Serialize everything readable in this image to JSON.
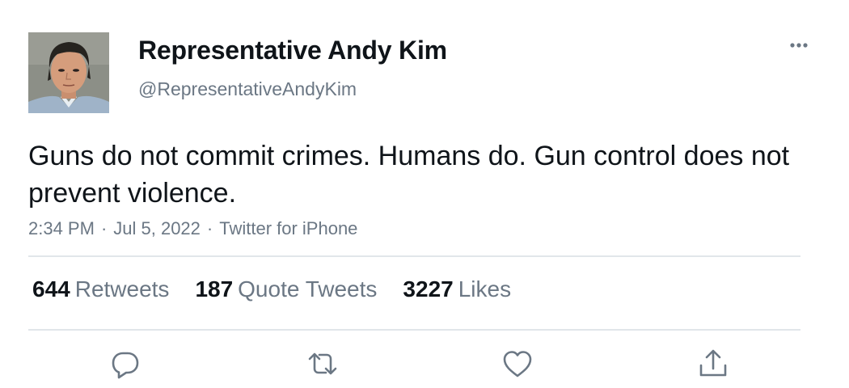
{
  "user": {
    "display_name": "Representative Andy Kim",
    "handle": "@RepresentativeAndyKim",
    "avatar_icon": "profile-photo"
  },
  "more_icon": "more-horizontal-icon",
  "tweet": {
    "text": "Guns do not commit crimes. Humans do. Gun control does not prevent violence.",
    "time": "2:34 PM",
    "date": "Jul 5, 2022",
    "source": "Twitter for iPhone",
    "separator": "·"
  },
  "stats": {
    "retweets": {
      "count": "644",
      "label": "Retweets"
    },
    "quote_tweets": {
      "count": "187",
      "label": "Quote Tweets"
    },
    "likes": {
      "count": "3227",
      "label": "Likes"
    }
  },
  "actions": {
    "reply_icon": "reply-icon",
    "retweet_icon": "retweet-icon",
    "like_icon": "heart-icon",
    "share_icon": "share-icon"
  },
  "colors": {
    "text": "#0f1419",
    "secondary": "#6b7784",
    "divider": "#e1e6ea"
  }
}
